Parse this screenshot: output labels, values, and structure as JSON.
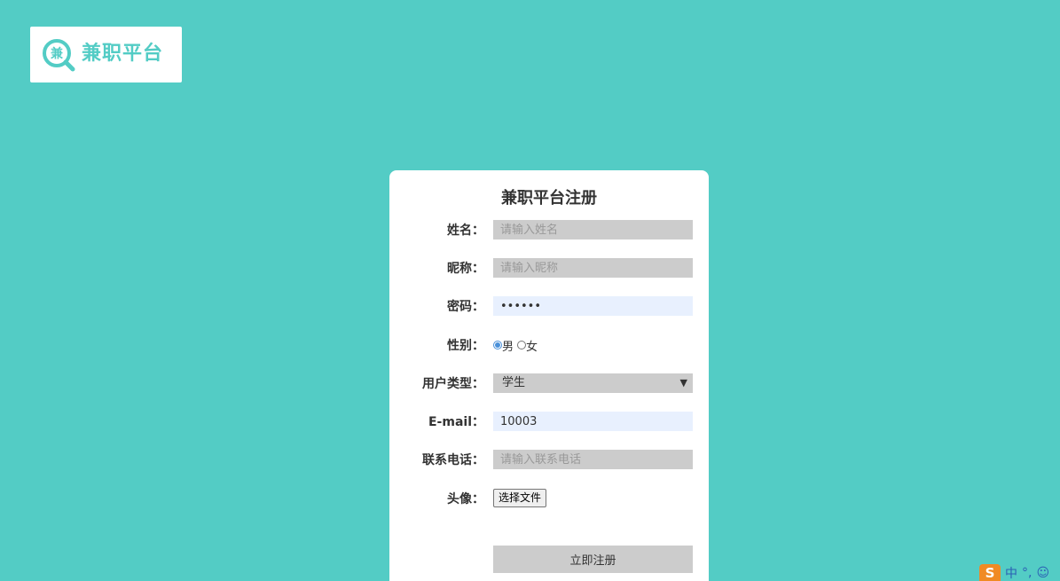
{
  "logo": {
    "mark_char": "兼",
    "text": "兼职平台"
  },
  "form": {
    "title": "兼职平台注册",
    "name": {
      "label": "姓名：",
      "value": "",
      "placeholder": "请输入姓名"
    },
    "nickname": {
      "label": "昵称：",
      "value": "",
      "placeholder": "请输入昵称"
    },
    "password": {
      "label": "密码：",
      "value": "••••••"
    },
    "gender": {
      "label": "性别：",
      "options": [
        "男",
        "女"
      ],
      "selected": "男"
    },
    "user_type": {
      "label": "用户类型：",
      "selected": "学生"
    },
    "email": {
      "label": "E-mail：",
      "value": "10003"
    },
    "phone": {
      "label": "联系电话：",
      "value": "",
      "placeholder": "请输入联系电话"
    },
    "avatar": {
      "label": "头像：",
      "button": "选择文件"
    },
    "submit_label": "立即注册"
  },
  "ime": {
    "logo_char": "S",
    "mode": "中",
    "punct": "°,",
    "emoji": "☺"
  },
  "colors": {
    "background": "#53ccc5",
    "accent": "#53ccc5",
    "field": "#cccccc",
    "autofill": "#e8f0fe"
  }
}
